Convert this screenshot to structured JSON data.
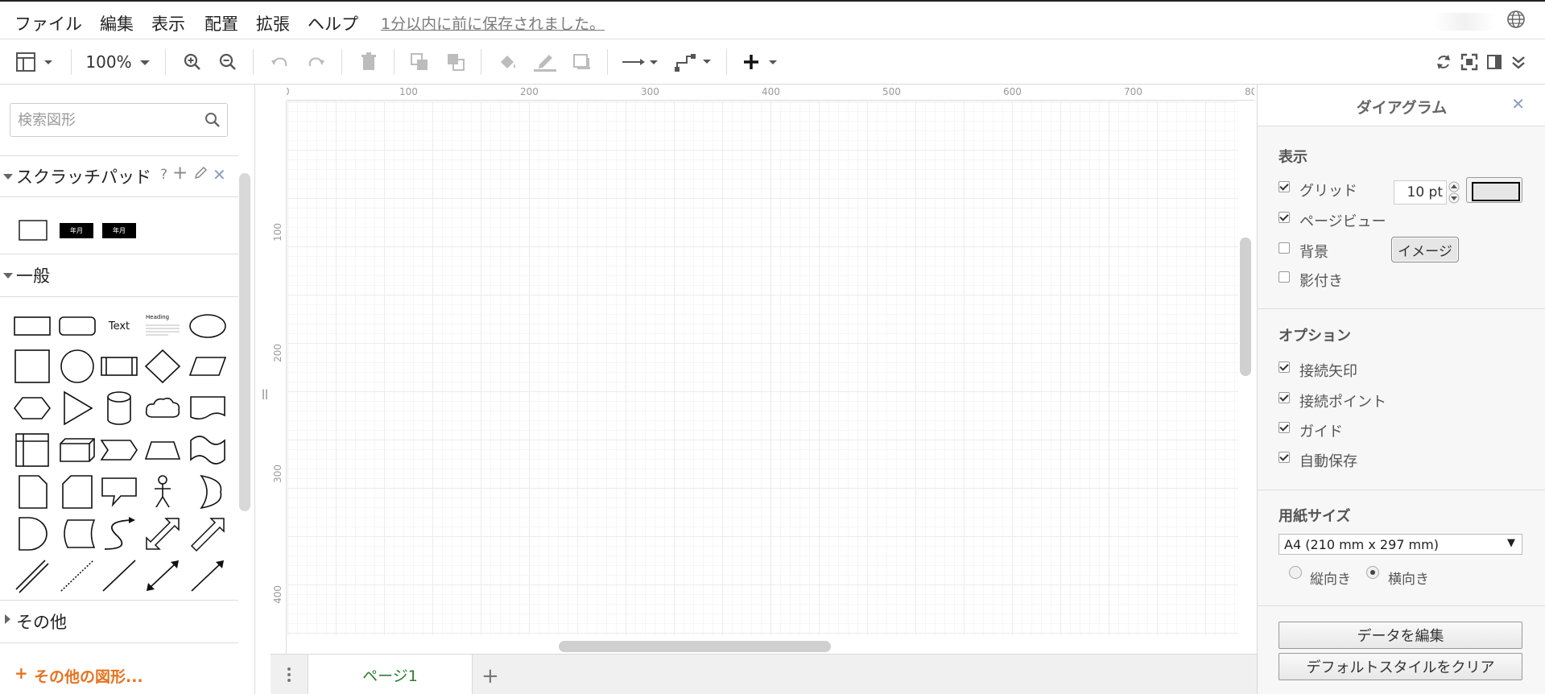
{
  "menubar": {
    "items": [
      "ファイル",
      "編集",
      "表示",
      "配置",
      "拡張",
      "ヘルプ"
    ],
    "save_status": "1分以内に前に保存されました。",
    "globe_icon": "globe-icon"
  },
  "toolbar": {
    "zoom": "100%"
  },
  "left_panel": {
    "search_placeholder": "検索図形",
    "scratchpad_title": "スクラッチパッド",
    "scratchpad_items": [
      "年月",
      "年月"
    ],
    "general_title": "一般",
    "other_title": "その他",
    "more_shapes": "その他の図形...",
    "shape_text": "Text",
    "shape_heading": "Heading"
  },
  "ruler": {
    "top": [
      "100",
      "200",
      "300",
      "400",
      "500",
      "600",
      "700",
      "80"
    ],
    "left": [
      "100",
      "200",
      "300",
      "400"
    ]
  },
  "page_tabs": {
    "active": "ページ1"
  },
  "right_panel": {
    "title": "ダイアグラム",
    "view_section": "表示",
    "grid_label": "グリッド",
    "grid_size": "10 pt",
    "pageview_label": "ページビュー",
    "background_label": "背景",
    "image_button": "イメージ",
    "shadow_label": "影付き",
    "options_section": "オプション",
    "connection_arrows": "接続矢印",
    "connection_points": "接続ポイント",
    "guides": "ガイド",
    "autosave": "自動保存",
    "paper_section": "用紙サイズ",
    "paper_size": "A4 (210 mm x 297 mm)",
    "portrait": "縦向き",
    "landscape": "横向き",
    "edit_data": "データを編集",
    "clear_default_style": "デフォルトスタイルをクリア",
    "checks": {
      "grid": true,
      "pageview": true,
      "background": false,
      "shadow": false,
      "connection_arrows": true,
      "connection_points": true,
      "guides": true,
      "autosave": true
    },
    "orientation": "landscape"
  }
}
